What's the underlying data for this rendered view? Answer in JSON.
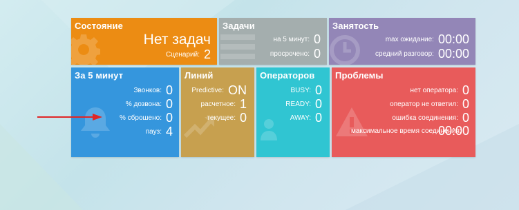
{
  "colors": {
    "state": "#ec8c13",
    "tasks": "#a4aeae",
    "busy": "#9386b7",
    "five_min": "#3596dd",
    "lines": "#c7a04f",
    "operators": "#30c5d2",
    "problems": "#e85b5b",
    "arrow": "#e02525"
  },
  "state": {
    "title": "Состояние",
    "status": "Нет задач",
    "scenario_label": "Сценарий:",
    "scenario_value": "2",
    "icon": "gear-icon"
  },
  "tasks": {
    "title": "Задачи",
    "rows": [
      {
        "label": "на 5 минут:",
        "value": "0"
      },
      {
        "label": "просрочено:",
        "value": "0"
      }
    ],
    "icon": "list-icon"
  },
  "busy": {
    "title": "Занятость",
    "rows": [
      {
        "label": "max ожидание:",
        "value": "00:00"
      },
      {
        "label": "средний разговор:",
        "value": "00:00"
      }
    ],
    "icon": "clock-icon"
  },
  "five_min": {
    "title": "За 5 минут",
    "rows": [
      {
        "label": "Звонков:",
        "value": "0"
      },
      {
        "label": "% дозвона:",
        "value": "0"
      },
      {
        "label": "% сброшено:",
        "value": "0"
      },
      {
        "label": "пауз:",
        "value": "4"
      }
    ],
    "icon": "bell-icon"
  },
  "lines": {
    "title": "Линий",
    "rows": [
      {
        "label": "Predictive:",
        "value": "ON"
      },
      {
        "label": "расчетное:",
        "value": "1"
      },
      {
        "label": "текущее:",
        "value": "0"
      }
    ],
    "icon": "trend-icon"
  },
  "operators": {
    "title": "Операторов",
    "rows": [
      {
        "label": "BUSY:",
        "value": "0"
      },
      {
        "label": "READY:",
        "value": "0"
      },
      {
        "label": "AWAY:",
        "value": "0"
      }
    ],
    "icon": "users-icon"
  },
  "problems": {
    "title": "Проблемы",
    "rows": [
      {
        "label": "нет оператора:",
        "value": "0"
      },
      {
        "label": "оператор не ответил:",
        "value": "0"
      },
      {
        "label": "ошибка соединения:",
        "value": "0"
      },
      {
        "label": "максимальное время соединения:",
        "value": "00:00"
      }
    ],
    "icon": "warning-icon"
  }
}
